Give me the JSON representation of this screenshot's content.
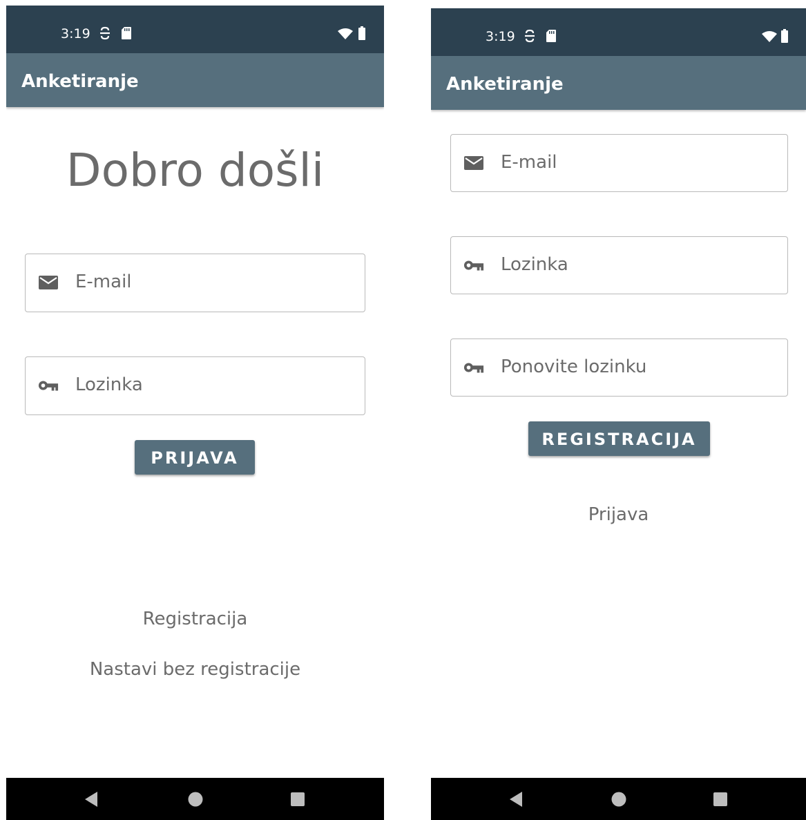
{
  "login_screen": {
    "status": {
      "time": "3:19"
    },
    "app_title": "Anketiranje",
    "welcome": "Dobro došli",
    "email_placeholder": "E-mail",
    "password_placeholder": "Lozinka",
    "login_button": "PRIJAVA",
    "register_link": "Registracija",
    "continue_link": "Nastavi bez registracije"
  },
  "register_screen": {
    "status": {
      "time": "3:19"
    },
    "app_title": "Anketiranje",
    "email_placeholder": "E-mail",
    "password_placeholder": "Lozinka",
    "repeat_password_placeholder": "Ponovite lozinku",
    "register_button": "REGISTRACIJA",
    "login_link": "Prijava"
  },
  "icons": {
    "status": [
      "sync-icon",
      "sd-card-icon",
      "wifi-icon",
      "battery-icon"
    ],
    "fields": [
      "mail-icon",
      "key-icon"
    ],
    "navigation": [
      "back-icon",
      "home-icon",
      "recents-icon"
    ]
  },
  "colors": {
    "status_bar": "#2c4150",
    "app_bar": "#566f7d",
    "button": "#566f7d",
    "placeholder_text": "#6b6b6b"
  }
}
